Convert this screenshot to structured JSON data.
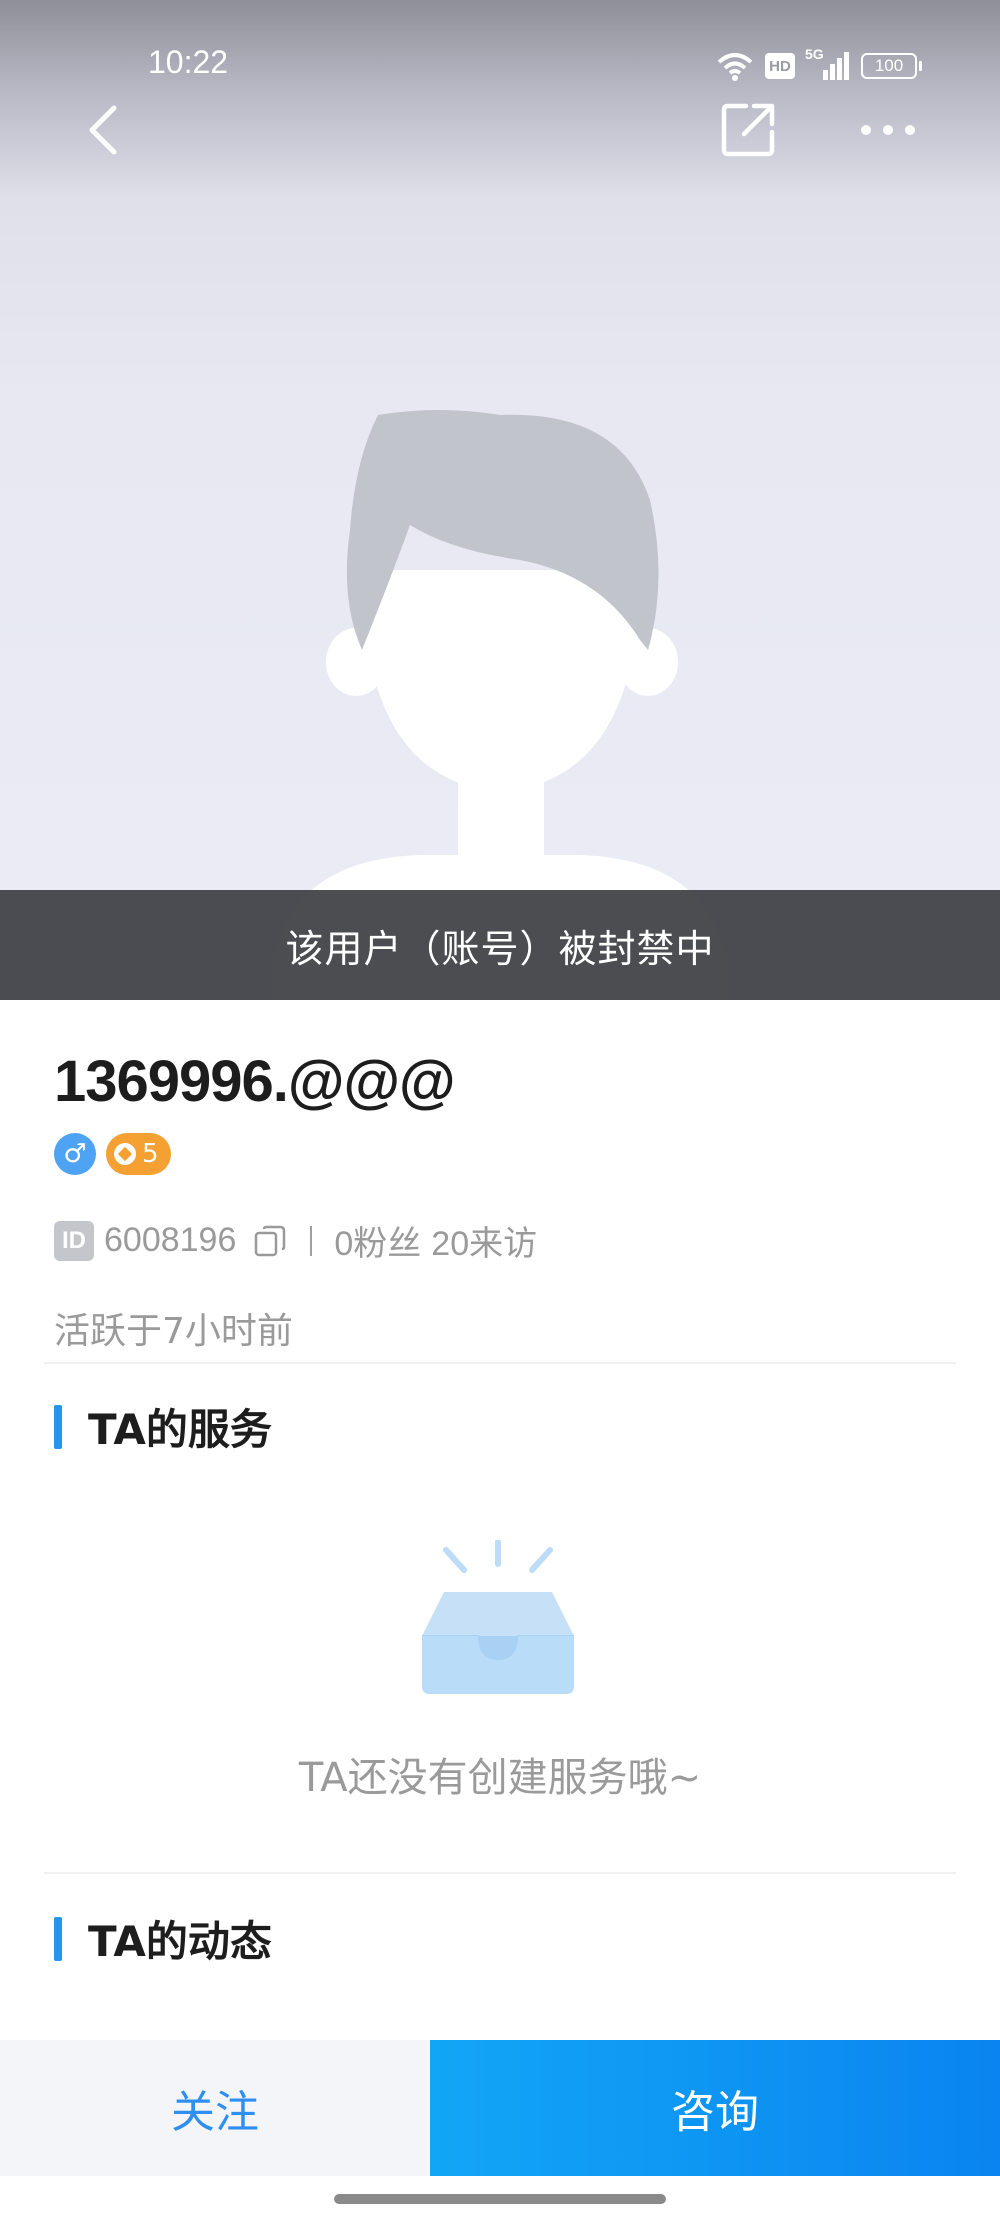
{
  "status_bar": {
    "time": "10:22",
    "network_label": "5G",
    "hd_label": "HD",
    "battery": "100"
  },
  "nav": {
    "back_icon": "chevron-left-icon",
    "share_icon": "share-icon",
    "more_icon": "more-dots-icon"
  },
  "banner": {
    "text": "该用户（账号）被封禁中"
  },
  "profile": {
    "username": "1369996.@@@",
    "gender_symbol": "♂",
    "level": "5",
    "id_label": "ID",
    "id_value": "6008196",
    "fans": "0粉丝",
    "visits": "20来访",
    "active": "活跃于7小时前"
  },
  "services": {
    "title": "TA的服务",
    "empty_text": "TA还没有创建服务哦~"
  },
  "posts": {
    "title": "TA的动态"
  },
  "actions": {
    "follow": "关注",
    "consult": "咨询"
  },
  "colors": {
    "accent": "#2196f3",
    "level_badge": "#f5a033",
    "gender_badge": "#4ea3f4",
    "consult_button": "#0a84f0"
  }
}
